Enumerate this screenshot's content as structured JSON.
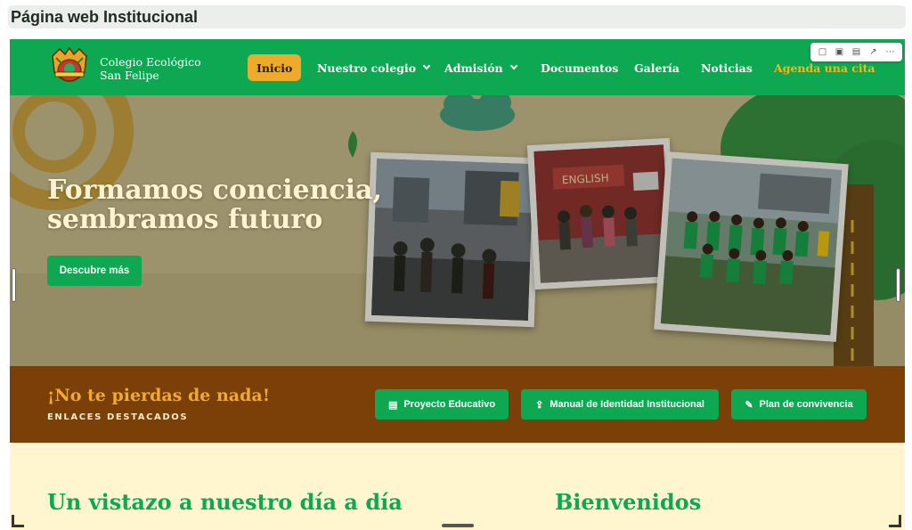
{
  "canvas": {
    "title": "Página web Institucional"
  },
  "header": {
    "brand_line1": "Colegio Ecológico",
    "brand_line2": "San Felipe",
    "menu": [
      {
        "label": "Inicio",
        "active": true
      },
      {
        "label": "Nuestro colegio",
        "dropdown": true
      },
      {
        "label": "Admisión",
        "dropdown": true
      },
      {
        "label": "Documentos"
      },
      {
        "label": "Galería"
      },
      {
        "label": "Noticias"
      },
      {
        "label": "Agenda una cita",
        "highlight": true
      }
    ]
  },
  "toolbar": {
    "icons": [
      "comment-icon",
      "frame-icon",
      "device-icon",
      "open-external-icon",
      "more-icon"
    ]
  },
  "hero": {
    "title_line1": "Formamos conciencia,",
    "title_line2": "sembramos futuro",
    "button_label": "Descubre más",
    "sign_text": "ENGLISH"
  },
  "banner": {
    "title": "¡No te pierdas de nada!",
    "subtitle": "ENLACES DESTACADOS",
    "links": [
      {
        "label": "Proyecto Educativo",
        "icon": "document-icon"
      },
      {
        "label": "Manual de Identidad Institucional",
        "icon": "upload-icon"
      },
      {
        "label": "Plan de convivencia",
        "icon": "clipboard-icon"
      }
    ]
  },
  "sections": {
    "left_heading": "Un vistazo a nuestro día a día",
    "right_heading": "Bienvenidos"
  },
  "colors": {
    "primary_green": "#0ea852",
    "accent_orange": "#eeaa2a",
    "banner_brown": "#7a4008",
    "cream": "#fff6d0"
  }
}
